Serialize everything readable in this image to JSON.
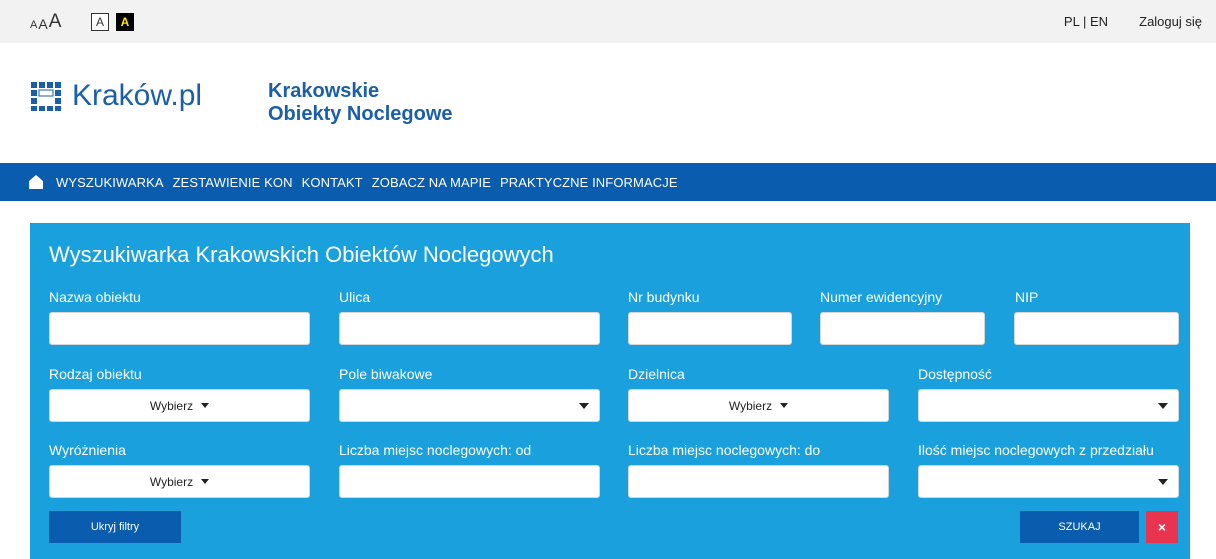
{
  "topbar": {
    "font_size_small": "A",
    "font_size_mid": "A",
    "font_size_big": "A",
    "contrast_normal": "A",
    "contrast_high": "A",
    "language": "PL | EN",
    "login": "Zaloguj się"
  },
  "header": {
    "logo_text": "Kraków.pl",
    "subtitle_line1": "Krakowskie",
    "subtitle_line2": "Obiekty Noclegowe"
  },
  "nav": {
    "items": [
      "WYSZUKIWARKA",
      "ZESTAWIENIE KON",
      "KONTAKT",
      "ZOBACZ NA MAPIE",
      "PRAKTYCZNE INFORMACJE"
    ]
  },
  "search": {
    "title": "Wyszukiwarka Krakowskich Obiektów Noclegowych",
    "fields": {
      "nazwa": {
        "label": "Nazwa obiektu",
        "value": ""
      },
      "ulica": {
        "label": "Ulica",
        "value": ""
      },
      "nr_budynku": {
        "label": "Nr budynku",
        "value": ""
      },
      "numer_ewidencyjny": {
        "label": "Numer ewidencyjny",
        "value": ""
      },
      "nip": {
        "label": "NIP",
        "value": ""
      },
      "rodzaj": {
        "label": "Rodzaj obiektu",
        "value": "Wybierz"
      },
      "pole_biwakowe": {
        "label": "Pole biwakowe",
        "value": ""
      },
      "dzielnica": {
        "label": "Dzielnica",
        "value": "Wybierz"
      },
      "dostepnosc": {
        "label": "Dostępność",
        "value": ""
      },
      "wyroznienia": {
        "label": "Wyróżnienia",
        "value": "Wybierz"
      },
      "liczba_od": {
        "label": "Liczba miejsc noclegowych: od",
        "value": ""
      },
      "liczba_do": {
        "label": "Liczba miejsc noclegowych: do",
        "value": ""
      },
      "ilosc_przedzialu": {
        "label": "Ilość miejsc noclegowych z przedziału",
        "value": ""
      }
    },
    "buttons": {
      "hide_filters": "Ukryj filtry",
      "search": "SZUKAJ",
      "clear": "×"
    }
  },
  "colors": {
    "nav_bg": "#0a5cae",
    "panel_bg": "#1aa0dc",
    "brand": "#1a5fa8",
    "clear_button": "#e8344e"
  }
}
